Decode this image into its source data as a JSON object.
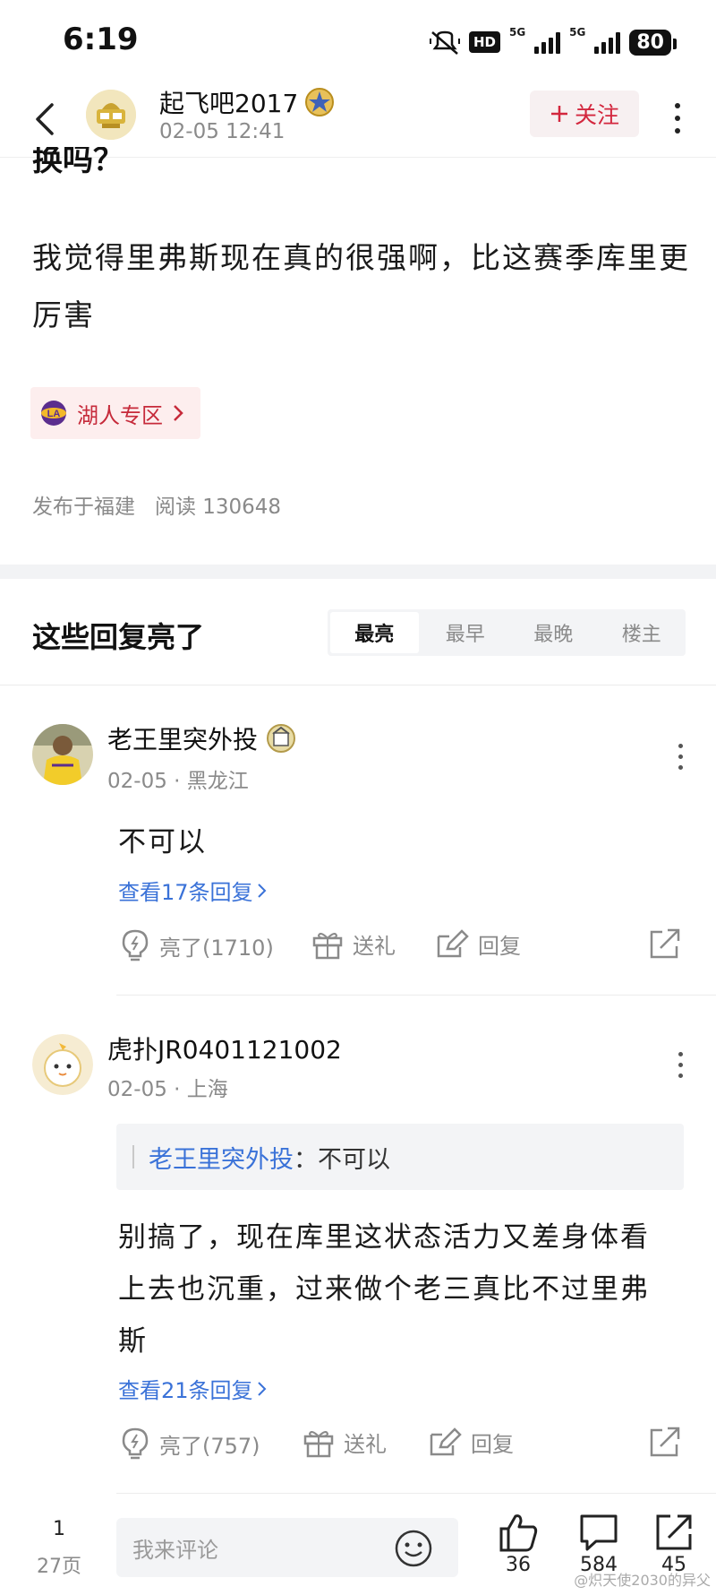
{
  "status": {
    "time": "6:19",
    "hd": "HD",
    "net1": "5G",
    "net2": "5G",
    "battery": "80"
  },
  "header": {
    "username": "起飞吧2017",
    "date": "02-05 12:41",
    "follow_label": "关注"
  },
  "post": {
    "title_tail": "换吗？",
    "body": "我觉得里弗斯现在真的很强啊，比这赛季库里更厉害",
    "zone_tag": "湖人专区",
    "zone_tag_logo": "LA",
    "location": "发布于福建",
    "reads": "阅读 130648"
  },
  "comments_section": {
    "title": "这些回复亮了",
    "tabs": [
      "最亮",
      "最早",
      "最晚",
      "楼主"
    ]
  },
  "comments": [
    {
      "user": "老王里突外投",
      "date": "02-05",
      "location": "黑龙江",
      "text": "不可以",
      "replies_link": "查看17条回复",
      "like_label": "亮了(1710)",
      "gift_label": "送礼",
      "reply_label": "回复"
    },
    {
      "user": "虎扑JR0401121002",
      "date": "02-05",
      "location": "上海",
      "quote_user": "老王里突外投",
      "quote_text": "：不可以",
      "text_line1": "别搞了，现在库里这状态活力又差身体看",
      "text_line2": "上去也沉重，过来做个老三真比不过里弗",
      "text_line3": "斯",
      "replies_link": "查看21条回复",
      "like_label": "亮了(757)",
      "gift_label": "送礼",
      "reply_label": "回复"
    }
  ],
  "bottom": {
    "page_current": "1",
    "page_total": "27页",
    "input_placeholder": "我来评论",
    "likes": "36",
    "comments": "584",
    "shares": "45",
    "watermark": "@炽天使2030的异父"
  },
  "colors": {
    "accent_red": "#d3273e",
    "link_blue": "#3a72d8",
    "muted": "#8a8a8a"
  }
}
